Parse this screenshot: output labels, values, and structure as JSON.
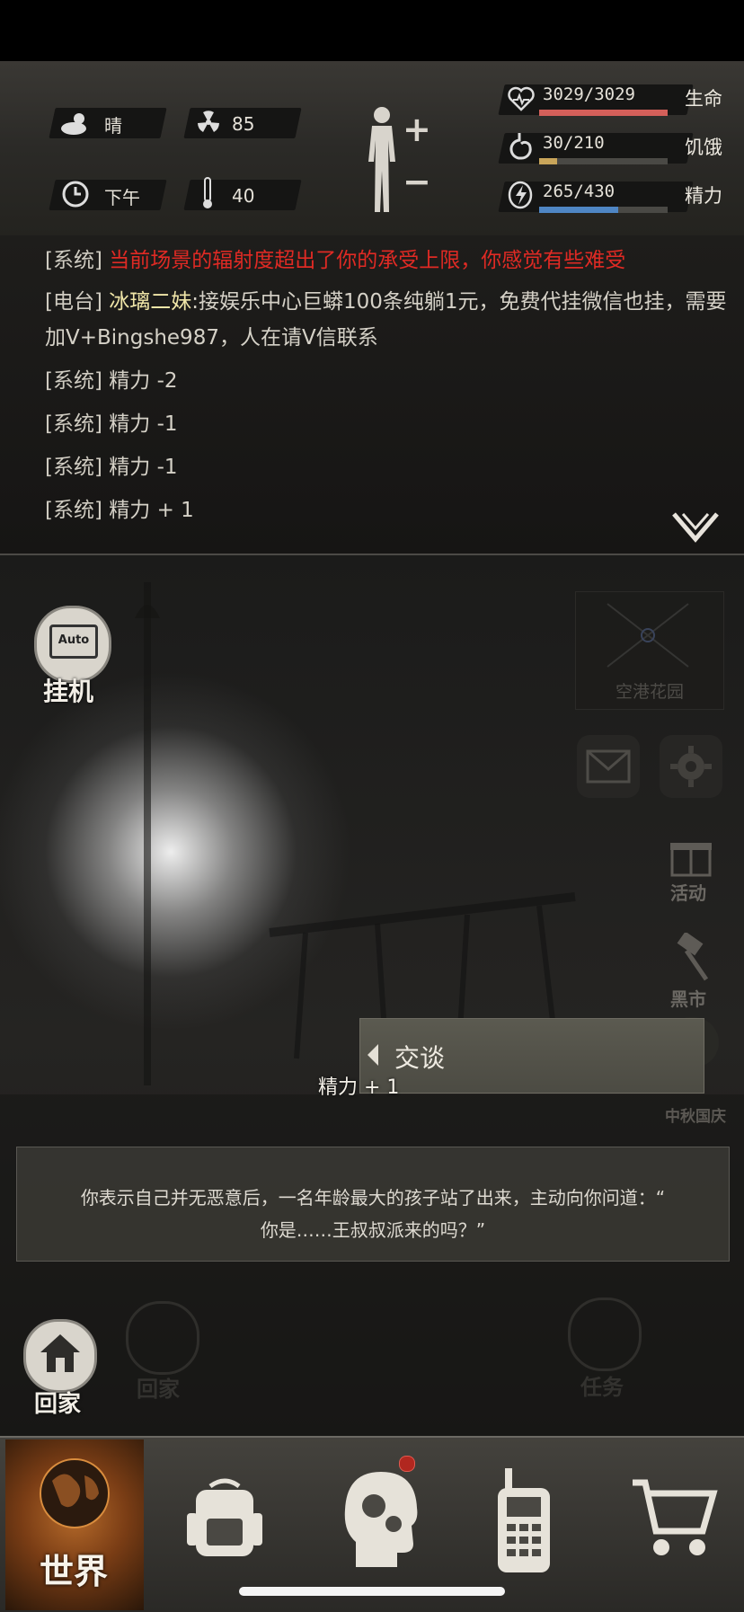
{
  "weather": {
    "label": "晴",
    "icon": "sun-cloud-icon"
  },
  "radiation": {
    "value": "85",
    "icon": "radiation-icon"
  },
  "time_of_day": {
    "label": "下午",
    "icon": "clock-icon"
  },
  "temperature": {
    "value": "40",
    "icon": "thermometer-icon"
  },
  "body_status": {
    "plus": "+",
    "minus": "−"
  },
  "vitals": {
    "health": {
      "label": "生命",
      "value": "3029/3029",
      "fraction": 1.0,
      "color": "#d4605a"
    },
    "hunger": {
      "label": "饥饿",
      "value": "30/210",
      "fraction": 0.143,
      "color": "#c9a55a"
    },
    "energy": {
      "label": "精力",
      "value": "265/430",
      "fraction": 0.616,
      "color": "#4f86c4"
    }
  },
  "log": [
    {
      "tag": "[系统]",
      "text": "当前场景的辐射度超出了你的承受上限，你感觉有些难受",
      "style": "red"
    },
    {
      "tag": "[电台]",
      "speaker": "冰璃二妹",
      "text": ":接娱乐中心巨蟒100条纯躺1元，免费代挂微信也挂，需要",
      "continuation": "加V+Bingshe987，人在请V信联系",
      "style": "yellow"
    },
    {
      "tag": "[系统]",
      "text": "精力 -2"
    },
    {
      "tag": "[系统]",
      "text": "精力 -1"
    },
    {
      "tag": "[系统]",
      "text": "精力 -1"
    },
    {
      "tag": "[系统]",
      "text": "精力 + 1"
    }
  ],
  "auto_button": {
    "icon_text": "Auto",
    "label": "挂机"
  },
  "minimap": {
    "label": "空港花园"
  },
  "side_buttons": {
    "event": "活动",
    "market": "黑市",
    "festival": "中秋国庆"
  },
  "talk_button": {
    "label": "交谈"
  },
  "float_text": "精力 + 1",
  "dialog": {
    "line1": "你表示自己并无恶意后，一名年龄最大的孩子站了出来，主动向你问道：“",
    "line2": "你是……王叔叔派来的吗？”"
  },
  "home_button": {
    "label": "回家"
  },
  "bg_buttons": {
    "home": "回家",
    "task": "任务"
  },
  "nav": {
    "world": "世界"
  }
}
